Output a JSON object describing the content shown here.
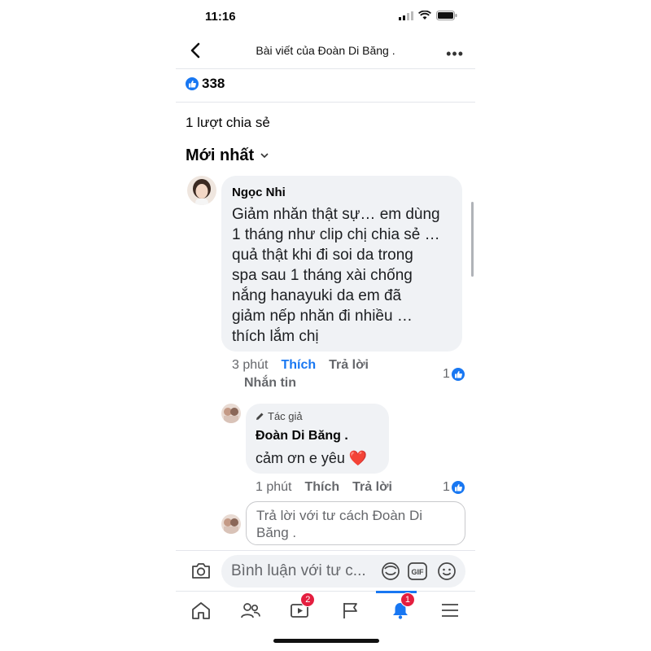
{
  "status_bar": {
    "time": "11:16"
  },
  "nav": {
    "title": "Bài viết của Đoàn Di Băng ."
  },
  "post": {
    "reaction_count": "338",
    "share_text": "1 lượt chia sẻ"
  },
  "sort": {
    "label": "Mới nhất"
  },
  "comments": [
    {
      "author": "Ngọc Nhi",
      "lines": [
        "Giảm nhăn thật sự… em dùng",
        "1 tháng như clip chị chia sẻ …",
        "quả thật khi đi soi da trong",
        "spa sau 1 tháng xài chống",
        "nắng hanayuki da em đã",
        "giảm nếp nhăn đi nhiều …",
        "thích lắm chị"
      ],
      "time": "3 phút",
      "like_label": "Thích",
      "reply_label": "Trả lời",
      "message_label": "Nhắn tin",
      "like_count": "1"
    }
  ],
  "reply": {
    "author_badge": "Tác giả",
    "author": "Đoàn Di Băng .",
    "text": "cảm ơn e yêu",
    "emoji": "❤️",
    "time": "1 phút",
    "like_label": "Thích",
    "reply_label": "Trả lời",
    "like_count": "1"
  },
  "reply_box": {
    "placeholder_line1": "Trả lời với tư cách Đoàn Di",
    "placeholder_line2": "Băng ."
  },
  "composer": {
    "placeholder": "Bình luận với tư c..."
  },
  "tabs": [
    {
      "icon": "home-icon"
    },
    {
      "icon": "friends-icon"
    },
    {
      "icon": "watch-icon",
      "badge": "2"
    },
    {
      "icon": "pages-flag-icon"
    },
    {
      "icon": "notifications-bell-icon",
      "badge": "1"
    },
    {
      "icon": "menu-icon"
    }
  ],
  "colors": {
    "accent": "#1877f2",
    "badge": "#e41e3f",
    "bubble": "#f0f2f5"
  }
}
